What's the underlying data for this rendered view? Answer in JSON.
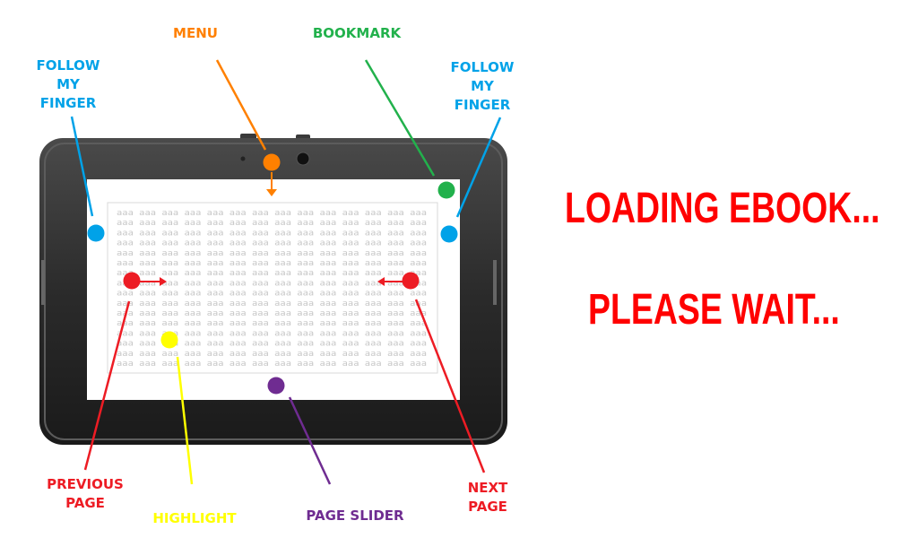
{
  "labels": {
    "menu": "MENU",
    "bookmark": "BOOKMARK",
    "follow_left": "FOLLOW\nMY\nFINGER",
    "follow_right": "FOLLOW\nMY\nFINGER",
    "previous_page": "PREVIOUS\nPAGE",
    "next_page": "NEXT\nPAGE",
    "highlight": "HIGHLIGHT",
    "page_slider": "PAGE SLIDER"
  },
  "status": {
    "loading": "LOADING EBOOK...",
    "wait": "PLEASE WAIT..."
  },
  "page_placeholder_text": "aaa aaa aaa aaa aaa aaa aaa aaa aaa aaa aaa aaa aaa aaa",
  "colors": {
    "menu": "#ff8000",
    "bookmark": "#22b14c",
    "follow": "#00a2e8",
    "page_nav": "#ed1c24",
    "highlight": "#ffff00",
    "page_slider": "#6f2c91",
    "status_text": "#ff0000"
  },
  "icons": {
    "menu_marker": "dot",
    "bookmark_marker": "dot",
    "follow_marker": "dot",
    "prev_marker": "dot-arrow-right",
    "next_marker": "dot-arrow-left",
    "highlight_marker": "dot",
    "slider_marker": "dot"
  }
}
